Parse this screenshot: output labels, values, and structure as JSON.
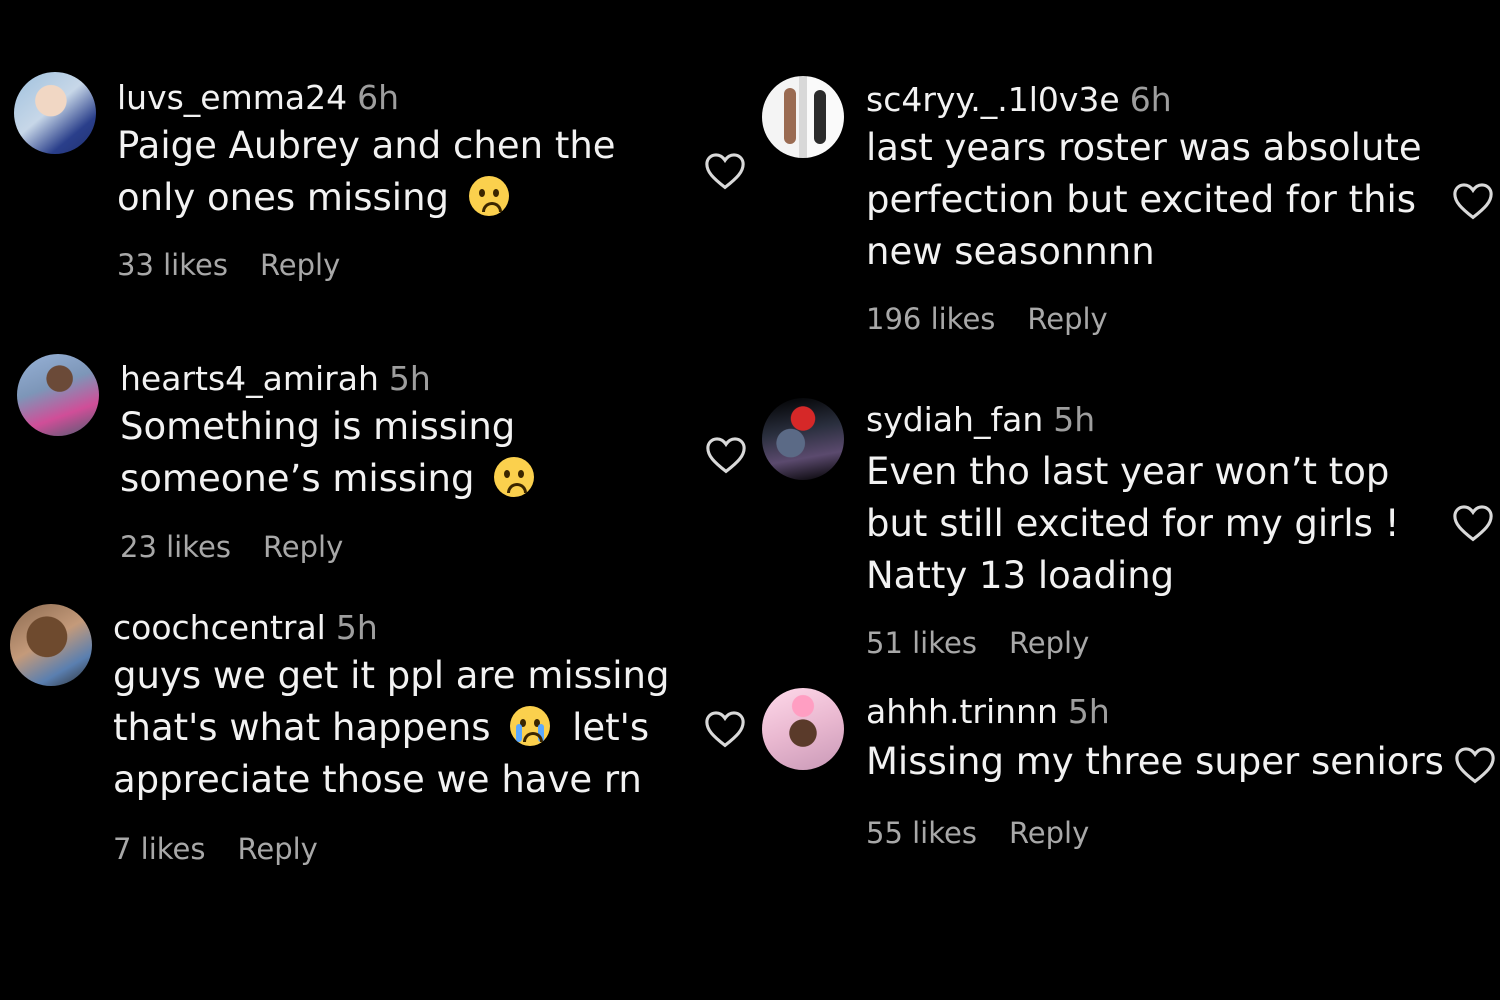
{
  "comments": [
    {
      "username": "luvs_emma24",
      "time": "6h",
      "lines": [
        "Paige Aubrey and chen the",
        "only ones missing"
      ],
      "emoji": "pleading-face",
      "likes": "33 likes",
      "reply": "Reply"
    },
    {
      "username": "hearts4_amirah",
      "time": "5h",
      "lines": [
        "Something is missing",
        "someone’s missing"
      ],
      "emoji": "pleading-face",
      "likes": "23 likes",
      "reply": "Reply"
    },
    {
      "username": "coochcentral",
      "time": "5h",
      "lines": [
        "guys we get it ppl are missing",
        "that's what happens",
        "let's",
        "appreciate those we have rn"
      ],
      "emoji": "loudly-crying-face",
      "likes": "7 likes",
      "reply": "Reply"
    },
    {
      "username": "sc4ryy._.1l0v3e",
      "time": "6h",
      "lines": [
        "last years roster was absolute",
        "perfection but excited for this",
        "new seasonnnn"
      ],
      "likes": "196 likes",
      "reply": "Reply"
    },
    {
      "username": "sydiah_fan",
      "time": "5h",
      "lines": [
        "Even tho last year won’t top",
        "but still excited for my girls !",
        "Natty 13 loading"
      ],
      "likes": "51 likes",
      "reply": "Reply"
    },
    {
      "username": "ahhh.trinnn",
      "time": "5h",
      "lines": [
        "Missing my three super seniors"
      ],
      "likes": "55 likes",
      "reply": "Reply"
    }
  ],
  "icons": {
    "like": "heart-outline-icon"
  },
  "colors": {
    "background": "#000000",
    "text": "#f2f2f2",
    "muted": "#a8a8a8"
  }
}
